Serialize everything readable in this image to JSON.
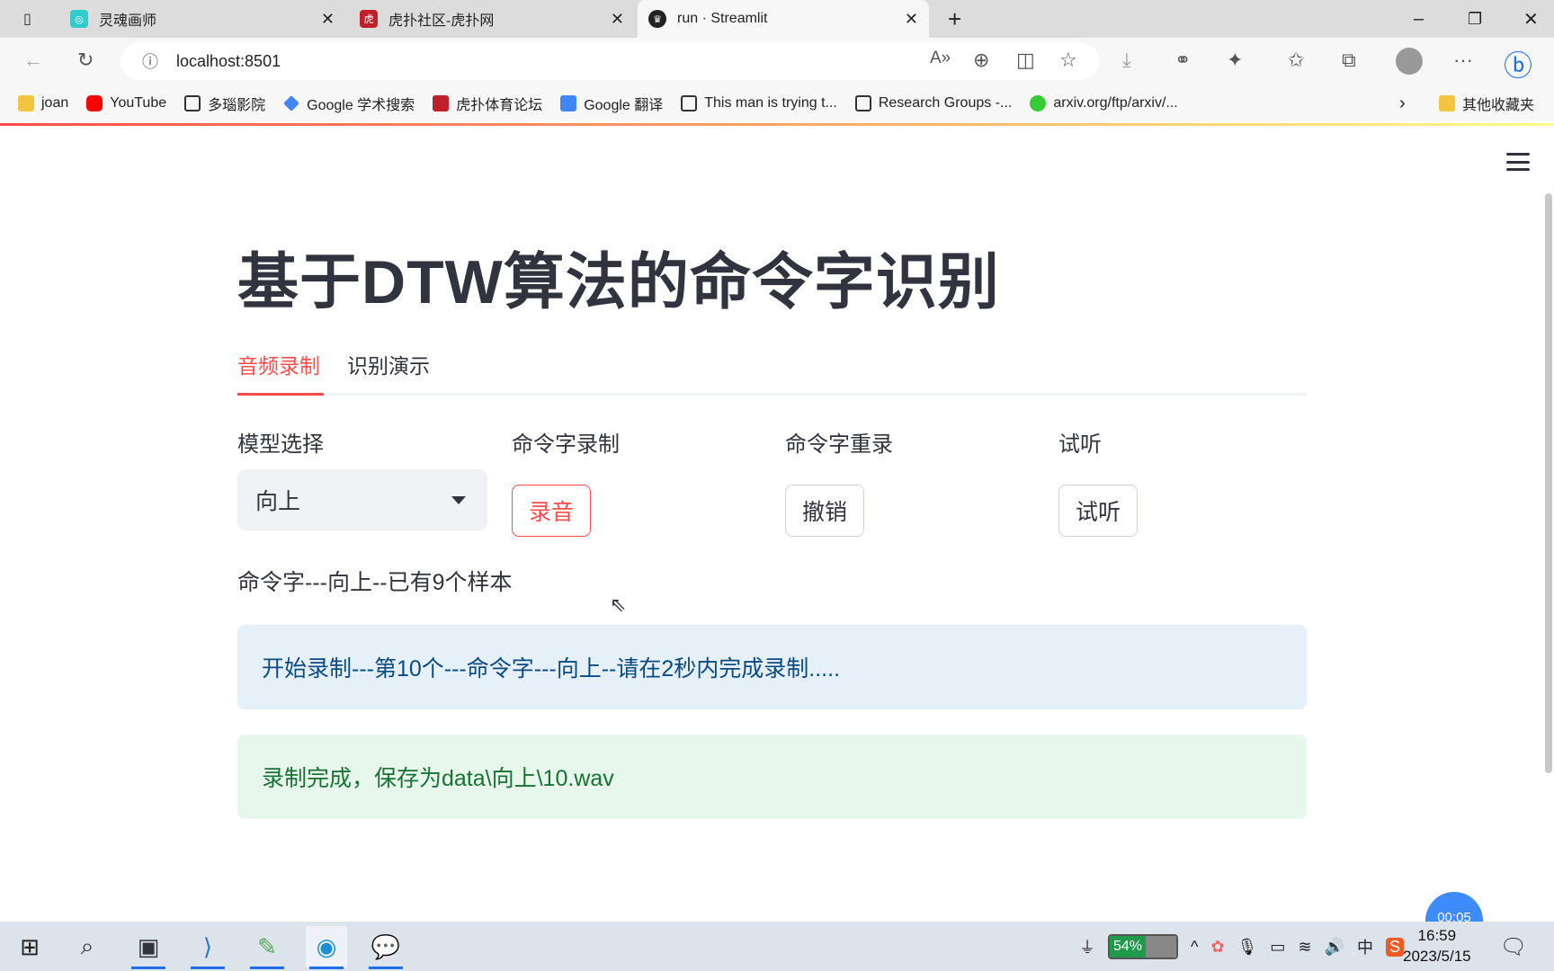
{
  "browser": {
    "tabs": [
      {
        "title": "灵魂画师",
        "active": false
      },
      {
        "title": "虎扑社区-虎扑网",
        "active": false
      },
      {
        "title": "run · Streamlit",
        "active": true
      }
    ],
    "url": "localhost:8501",
    "bookmarks": [
      "joan",
      "YouTube",
      "多瑙影院",
      "Google 学术搜索",
      "虎扑体育论坛",
      "Google 翻译",
      "This man is trying t...",
      "Research Groups -...",
      "arxiv.org/ftp/arxiv/..."
    ],
    "other_bookmarks": "其他收藏夹"
  },
  "app": {
    "title": "基于DTW算法的命令字识别",
    "tabs": [
      {
        "label": "音频录制",
        "active": true
      },
      {
        "label": "识别演示",
        "active": false
      }
    ],
    "columns": {
      "model": {
        "label": "模型选择",
        "selected": "向上"
      },
      "record": {
        "label": "命令字录制",
        "button": "录音"
      },
      "rerecord": {
        "label": "命令字重录",
        "button": "撤销"
      },
      "listen": {
        "label": "试听",
        "button": "试听"
      }
    },
    "status": "命令字---向上--已有9个样本",
    "info": "开始录制---第10个---命令字---向上--请在2秒内完成录制.....",
    "success": "录制完成，保存为data\\向上\\10.wav",
    "accent_color": "#ff4b4b"
  },
  "overlay_timer": "00:05",
  "taskbar": {
    "battery": "54%",
    "battery_level": 54,
    "ime": "中",
    "time": "16:59",
    "date": "2023/5/15"
  }
}
